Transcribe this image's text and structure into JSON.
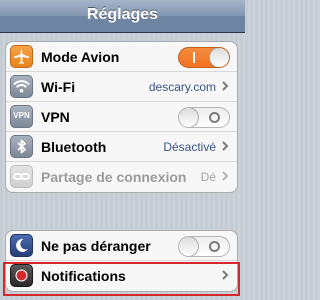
{
  "navbar": {
    "title": "Réglages"
  },
  "group1": {
    "rows": [
      {
        "label": "Mode Avion",
        "icon": "airplane-icon",
        "toggle": "on"
      },
      {
        "label": "Wi-Fi",
        "icon": "wifi-icon",
        "value": "descary.com"
      },
      {
        "label": "VPN",
        "icon": "vpn-icon",
        "icon_text": "VPN",
        "toggle": "off"
      },
      {
        "label": "Bluetooth",
        "icon": "bluetooth-icon",
        "value": "Désactivé"
      },
      {
        "label": "Partage de connexion",
        "icon": "link-icon",
        "value": "Dé",
        "disabled": true
      }
    ]
  },
  "group2": {
    "rows": [
      {
        "label": "Ne pas déranger",
        "icon": "moon-icon",
        "toggle": "off"
      },
      {
        "label": "Notifications",
        "icon": "notifications-icon"
      }
    ]
  },
  "colors": {
    "navbar": "#6d84a2",
    "toggle_on": "#f27222",
    "value_text": "#385487",
    "highlight": "#d8262c"
  }
}
